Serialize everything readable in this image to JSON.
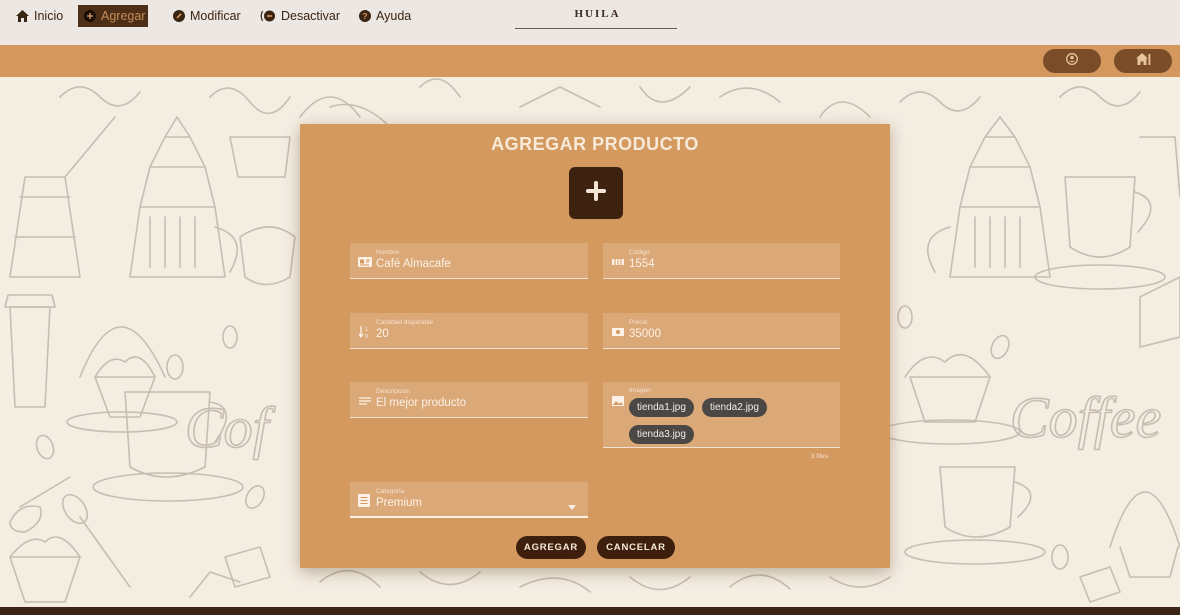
{
  "header": {
    "brand": "HUILA"
  },
  "nav": {
    "items": [
      {
        "label": "Inicio",
        "icon": "home-icon"
      },
      {
        "label": "Agregar",
        "icon": "plus-circle-icon",
        "active": true
      },
      {
        "label": "Modificar",
        "icon": "edit-circle-icon"
      },
      {
        "label": "Desactivar",
        "icon": "minus-circle-icon"
      },
      {
        "label": "Ayuda",
        "icon": "help-circle-icon"
      }
    ],
    "right_buttons": [
      {
        "icon": "account-icon"
      },
      {
        "icon": "home-alt-icon"
      }
    ]
  },
  "form": {
    "title": "AGREGAR PRODUCTO",
    "fields": {
      "nombre": {
        "label": "Nombre",
        "value": "Café Almacafe",
        "icon": "id-card-icon"
      },
      "codigo": {
        "label": "Código",
        "value": "1554",
        "icon": "barcode-icon"
      },
      "cantidad": {
        "label": "Cantidad disponible",
        "value": "20",
        "icon": "sort-numeric-icon"
      },
      "precio": {
        "label": "Precio",
        "value": "35000",
        "icon": "cash-icon"
      },
      "descripcion": {
        "label": "Descripción",
        "value": "El mejor producto",
        "icon": "text-icon"
      },
      "imagen": {
        "label": "Imagen",
        "icon": "image-icon",
        "files": [
          "tienda1.jpg",
          "tienda2.jpg",
          "tienda3.jpg"
        ],
        "count_label": "3 files"
      },
      "categoria": {
        "label": "Categoria",
        "value": "Premium",
        "icon": "list-box-icon"
      }
    },
    "buttons": {
      "add": "AGREGAR",
      "cancel": "CANCELAR"
    }
  },
  "colors": {
    "navbar": "#d4985f",
    "card": "#d4995e",
    "dark_brown": "#3e1f0d",
    "background": "#f3ede2"
  }
}
